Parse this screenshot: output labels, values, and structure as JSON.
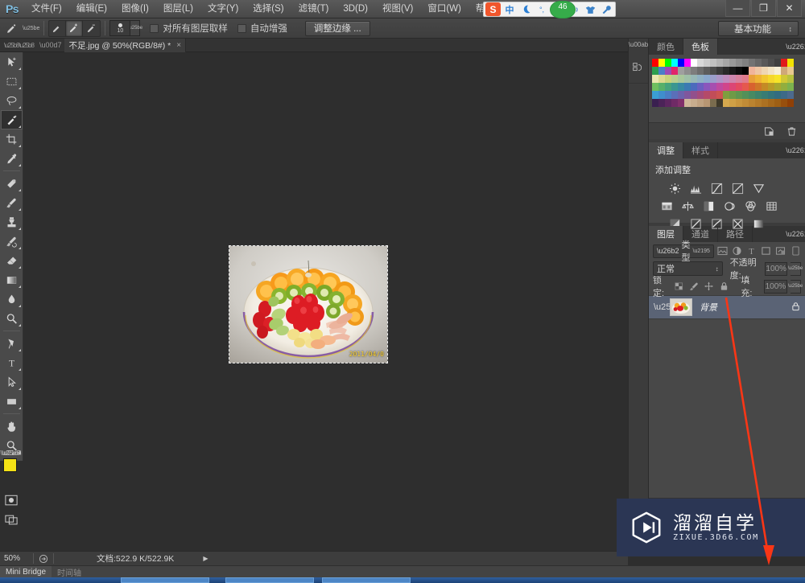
{
  "app": {
    "logo": "Ps",
    "workspace": "基本功能"
  },
  "menubar": {
    "items": [
      {
        "label": "文件(F)"
      },
      {
        "label": "编辑(E)"
      },
      {
        "label": "图像(I)"
      },
      {
        "label": "图层(L)"
      },
      {
        "label": "文字(Y)"
      },
      {
        "label": "选择(S)"
      },
      {
        "label": "滤镜(T)"
      },
      {
        "label": "3D(D)"
      },
      {
        "label": "视图(V)"
      },
      {
        "label": "窗口(W)"
      },
      {
        "label": "帮助(H)"
      }
    ]
  },
  "ime": {
    "sogou": "S",
    "mode": "中",
    "badge": "46",
    "icons": [
      "moon-icon",
      "degree-icon",
      "keyboard-icon",
      "speaker-icon",
      "shirt-icon",
      "wrench-icon"
    ]
  },
  "window_controls": {
    "minimize": "—",
    "restore": "❐",
    "close": "✕"
  },
  "options_bar": {
    "tool": "quick-selection-tool",
    "modes": [
      "new-selection",
      "add-to-selection",
      "subtract-from-selection"
    ],
    "selected_mode": "add-to-selection",
    "brush_size": "10",
    "sample_all_layers": {
      "label": "对所有图层取样",
      "checked": false
    },
    "auto_enhance": {
      "label": "自动增强",
      "checked": false
    },
    "refine_edge": "调整边缘 ..."
  },
  "document_tab": {
    "title": "不足.jpg @ 50%(RGB/8#) *",
    "close": "×"
  },
  "toolbar": {
    "tools": [
      {
        "name": "move-tool",
        "active": false
      },
      {
        "name": "rectangular-marquee-tool",
        "active": false
      },
      {
        "name": "lasso-tool",
        "active": false
      },
      {
        "name": "quick-selection-tool",
        "active": true
      },
      {
        "name": "crop-tool",
        "active": false
      },
      {
        "name": "eyedropper-tool",
        "active": false
      },
      {
        "name": "spot-healing-brush-tool",
        "active": false
      },
      {
        "name": "brush-tool",
        "active": false
      },
      {
        "name": "clone-stamp-tool",
        "active": false
      },
      {
        "name": "history-brush-tool",
        "active": false
      },
      {
        "name": "eraser-tool",
        "active": false
      },
      {
        "name": "gradient-tool",
        "active": false
      },
      {
        "name": "blur-tool",
        "active": false
      },
      {
        "name": "dodge-tool",
        "active": false
      },
      {
        "name": "pen-tool",
        "active": false
      },
      {
        "name": "horizontal-type-tool",
        "active": false
      },
      {
        "name": "path-selection-tool",
        "active": false
      },
      {
        "name": "rectangle-tool",
        "active": false
      },
      {
        "name": "hand-tool",
        "active": false
      },
      {
        "name": "zoom-tool",
        "active": false
      }
    ],
    "foreground_color": "#f5e215",
    "background_color": "#ffffff",
    "quick_mask": "quick-mask-icon",
    "screen_mode": "screen-mode-icon"
  },
  "canvas": {
    "image_alt": "fruit-platter-photo",
    "datestamp": "2011/04/0"
  },
  "panels": {
    "color": {
      "tabs": [
        {
          "label": "颜色",
          "active": false
        },
        {
          "label": "色板",
          "active": true
        }
      ],
      "menu": "panel-menu-icon",
      "footer_icons": [
        "new-swatch-icon",
        "delete-swatch-icon"
      ]
    },
    "adjustments": {
      "tabs": [
        {
          "label": "调整",
          "active": true
        },
        {
          "label": "样式",
          "active": false
        }
      ],
      "title": "添加调整",
      "row1": [
        "brightness-contrast-icon",
        "levels-icon",
        "curves-icon",
        "exposure-icon",
        "vibrance-icon"
      ],
      "row2": [
        "hue-saturation-icon",
        "color-balance-icon",
        "black-white-icon",
        "photo-filter-icon",
        "channel-mixer-icon",
        "color-lookup-icon"
      ],
      "row3": [
        "invert-icon",
        "posterize-icon",
        "threshold-icon",
        "selective-color-icon",
        "gradient-map-icon"
      ]
    },
    "layers": {
      "tabs": [
        {
          "label": "图层",
          "active": true
        },
        {
          "label": "通道",
          "active": false
        },
        {
          "label": "路径",
          "active": false
        }
      ],
      "filter": {
        "icon": "search-icon",
        "value": "类型"
      },
      "filter_icons": [
        "pixel-filter-icon",
        "adjustment-filter-icon",
        "type-filter-icon",
        "shape-filter-icon",
        "smart-object-filter-icon",
        "filter-toggle-icon"
      ],
      "blend_mode": "正常",
      "opacity_label": "不透明度:",
      "opacity_value": "100%",
      "lock_label": "锁定:",
      "lock_icons": [
        "lock-transparent-icon",
        "lock-image-icon",
        "lock-position-icon",
        "lock-all-icon"
      ],
      "fill_label": "填充:",
      "fill_value": "100%",
      "items": [
        {
          "name": "背景",
          "visible": true,
          "locked": true,
          "selected": true
        }
      ],
      "footer_icons": [
        "link-layers-icon",
        "layer-style-icon",
        "layer-mask-icon",
        "new-adjustment-layer-icon",
        "new-group-icon",
        "new-layer-icon",
        "delete-layer-icon"
      ],
      "highlighted_footer_icon": "new-layer-icon"
    }
  },
  "status_bar": {
    "zoom": "50%",
    "doc_info": "文档:522.9 K/522.9K",
    "expand_arrow": "▶"
  },
  "bottom_tabs": [
    {
      "label": "Mini Bridge",
      "active": true
    },
    {
      "label": "时间轴",
      "active": false
    }
  ],
  "watermark": {
    "title": "溜溜自学",
    "subtitle": "ZIXUE.3D66.COM",
    "logo": "play-button-logo"
  },
  "annotation": {
    "color": "#f93616",
    "shape": "red-arrow-pointing-to-new-layer-button"
  },
  "colors": {
    "menu_bg": "#4f4f4f",
    "panel_bg": "#484848",
    "dock_bg": "#3c3c3c",
    "canvas_bg": "#2e2e2e",
    "selection_blue": "#5a6375",
    "accent_red": "#f93616",
    "watermark_bg": "#2b3654"
  },
  "swatch_rows": [
    [
      "#ff0000",
      "#ffff00",
      "#00ff00",
      "#00ffff",
      "#0000ff",
      "#ff00ff",
      "#ffffff",
      "#d9d9d9",
      "#cccccc",
      "#c0c0c0",
      "#b3b3b3",
      "#a6a6a6",
      "#999999",
      "#8c8c8c",
      "#808080",
      "#737373",
      "#666666",
      "#595959",
      "#4d4d4d",
      "#404040",
      "#e01b1b",
      "#f2e200"
    ],
    [
      "#2e9e4f",
      "#4a7ec8",
      "#9b4bb5",
      "#e0256b",
      "#9f9f9f",
      "#8e8e8e",
      "#7d7d7d",
      "#6d6d6d",
      "#5c5c5c",
      "#4b4b4b",
      "#3a3a3a",
      "#2a2a2a",
      "#1a1a1a",
      "#0d0d0d",
      "#000000",
      "#f0b49a",
      "#eec6a4",
      "#efd6b1",
      "#f2e3c3",
      "#f6eed6",
      "#cfa878",
      "#e8c98f"
    ],
    [
      "#eae7b0",
      "#dcd990",
      "#c8d37c",
      "#b7cf8e",
      "#a8c79b",
      "#9fc0a8",
      "#97b8b6",
      "#8fb0c3",
      "#8aa8cd",
      "#9b9ecb",
      "#ad95c6",
      "#bf8cbd",
      "#cd86ad",
      "#d7819c",
      "#e07b8c",
      "#e8a03a",
      "#eeb335",
      "#f2c62f",
      "#f5d72b",
      "#f7e427",
      "#d1c935",
      "#b7c13f"
    ],
    [
      "#6fbf5f",
      "#57b06a",
      "#46a37c",
      "#3b9790",
      "#3789a3",
      "#3a7ab2",
      "#4c6bbd",
      "#6b5fc0",
      "#8a56bc",
      "#a64fb0",
      "#bf4a9f",
      "#d0468b",
      "#dc4675",
      "#e34b60",
      "#e5584e",
      "#d8622f",
      "#cf7628",
      "#c48a25",
      "#b79b28",
      "#a8a830",
      "#92ae3e",
      "#7cb24e"
    ],
    [
      "#3a9fd4",
      "#3f8ecd",
      "#4a7ec4",
      "#5a6fb9",
      "#6c62ac",
      "#7f579d",
      "#92508c",
      "#a44b7b",
      "#b44a69",
      "#c24d58",
      "#cc5450",
      "#7f9e3e",
      "#6e9a47",
      "#5f9550",
      "#529059",
      "#478a62",
      "#3e836b",
      "#387c73",
      "#34747a",
      "#336c80",
      "#3d6a88",
      "#4c6a8e"
    ],
    [
      "#3a2050",
      "#4b2358",
      "#5d2660",
      "#6f2a66",
      "#81306b",
      "#cfb79a",
      "#c7ac8d",
      "#bfa180",
      "#b79673",
      "#7a6c4e",
      "#3f3a2a",
      "#d6a94e",
      "#cfa046",
      "#c8963e",
      "#c18c37",
      "#ba8330",
      "#b37a29",
      "#ac7122",
      "#a5681b",
      "#9e5f14",
      "#974f0d",
      "#904006"
    ]
  ]
}
